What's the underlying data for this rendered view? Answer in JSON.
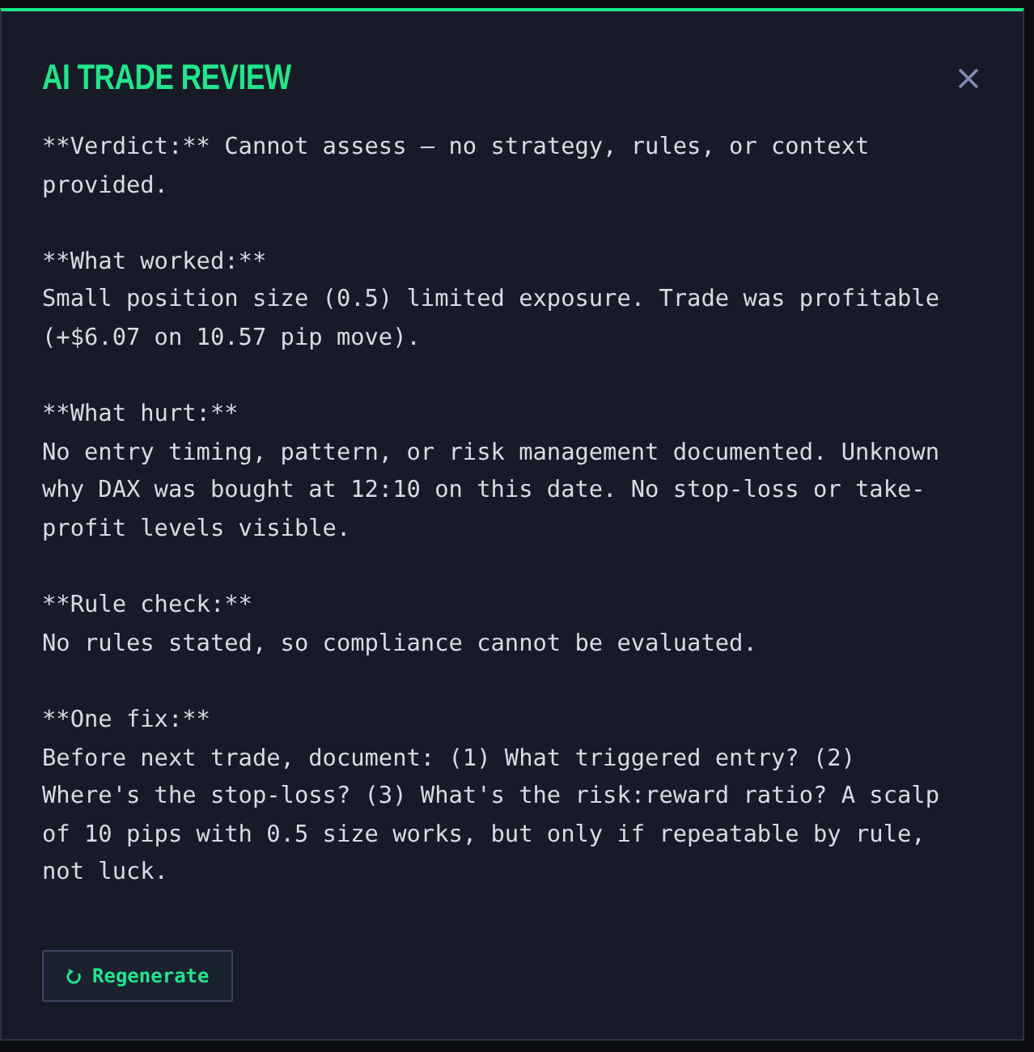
{
  "dialog": {
    "title": "AI TRADE REVIEW"
  },
  "review": [
    {
      "kind": "paragraph",
      "text": "**Verdict:** Cannot assess — no strategy, rules, or context provided."
    },
    {
      "kind": "section",
      "heading": "**What worked:**",
      "text": "Small position size (0.5) limited exposure. Trade was profitable (+$6.07 on 10.57 pip move)."
    },
    {
      "kind": "section",
      "heading": "**What hurt:**",
      "text": "No entry timing, pattern, or risk management documented. Unknown why DAX was bought at 12:10 on this date. No stop-loss or take-profit levels visible."
    },
    {
      "kind": "section",
      "heading": "**Rule check:**",
      "text": "No rules stated, so compliance cannot be evaluated."
    },
    {
      "kind": "section",
      "heading": "**One fix:**",
      "text": "Before next trade, document: (1) What triggered entry? (2) Where's the stop-loss? (3) What's the risk:reward ratio? A scalp of 10 pips with 0.5 size works, but only if repeatable by rule, not luck."
    }
  ],
  "actions": [
    {
      "kind": "regenerate",
      "label": "Regenerate"
    }
  ]
}
